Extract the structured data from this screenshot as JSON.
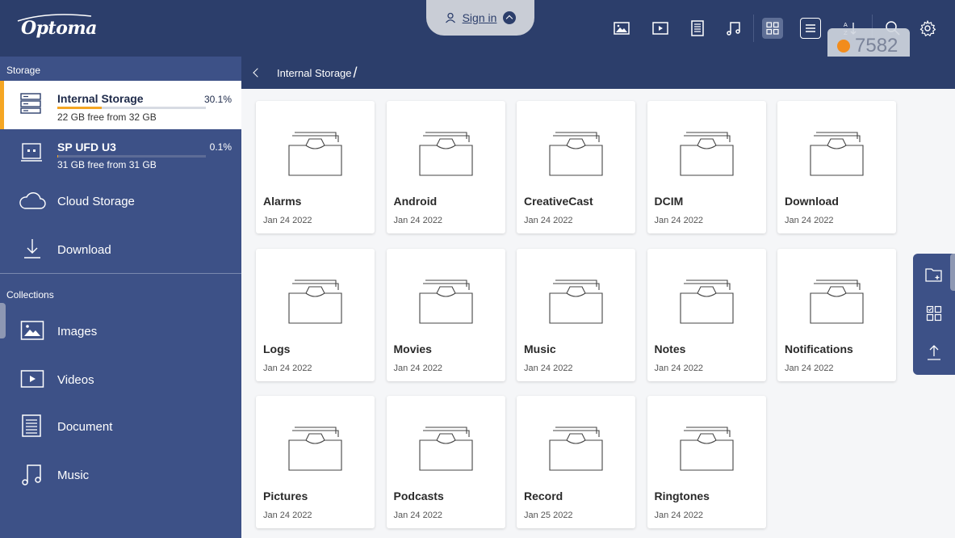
{
  "app": {
    "logo_text": "Optoma"
  },
  "header": {
    "signin_label": "Sign in",
    "counter_value": "7582",
    "toolbar_icons": [
      "images-filter-icon",
      "videos-filter-icon",
      "document-filter-icon",
      "music-filter-icon",
      "grid-view-icon",
      "list-view-icon",
      "sort-az-icon",
      "search-icon",
      "settings-gear-icon"
    ]
  },
  "sidebar": {
    "storage_label": "Storage",
    "collections_label": "Collections",
    "storage_items": [
      {
        "title": "Internal Storage",
        "subtitle": "22 GB free from 32 GB",
        "percent": "30.1%",
        "usage_fraction": 0.301
      },
      {
        "title": "SP UFD U3",
        "subtitle": "31 GB free from 31 GB",
        "percent": "0.1%",
        "usage_fraction": 0.001
      }
    ],
    "cloud_label": "Cloud Storage",
    "download_label": "Download",
    "collections": [
      {
        "label": "Images",
        "icon": "image-icon"
      },
      {
        "label": "Videos",
        "icon": "video-icon"
      },
      {
        "label": "Document",
        "icon": "document-icon"
      },
      {
        "label": "Music",
        "icon": "music-icon"
      }
    ]
  },
  "breadcrumb": {
    "path": "Internal Storage",
    "separator": "/"
  },
  "folders": [
    {
      "name": "Alarms",
      "date": "Jan 24 2022"
    },
    {
      "name": "Android",
      "date": "Jan 24 2022"
    },
    {
      "name": "CreativeCast",
      "date": "Jan 24 2022"
    },
    {
      "name": "DCIM",
      "date": "Jan 24 2022"
    },
    {
      "name": "Download",
      "date": "Jan 24 2022"
    },
    {
      "name": "Logs",
      "date": "Jan 24 2022"
    },
    {
      "name": "Movies",
      "date": "Jan 24 2022"
    },
    {
      "name": "Music",
      "date": "Jan 24 2022"
    },
    {
      "name": "Notes",
      "date": "Jan 24 2022"
    },
    {
      "name": "Notifications",
      "date": "Jan 24 2022"
    },
    {
      "name": "Pictures",
      "date": "Jan 24 2022"
    },
    {
      "name": "Podcasts",
      "date": "Jan 24 2022"
    },
    {
      "name": "Record",
      "date": "Jan 25 2022"
    },
    {
      "name": "Ringtones",
      "date": "Jan 24 2022"
    }
  ],
  "right_panel": {
    "icons": [
      "new-folder-icon",
      "multi-select-icon",
      "upload-icon"
    ]
  },
  "colors": {
    "header_bg": "#2c3e6b",
    "sidebar_bg": "#3d5187",
    "accent": "#f5a623",
    "badge_dot": "#f28c1c"
  }
}
